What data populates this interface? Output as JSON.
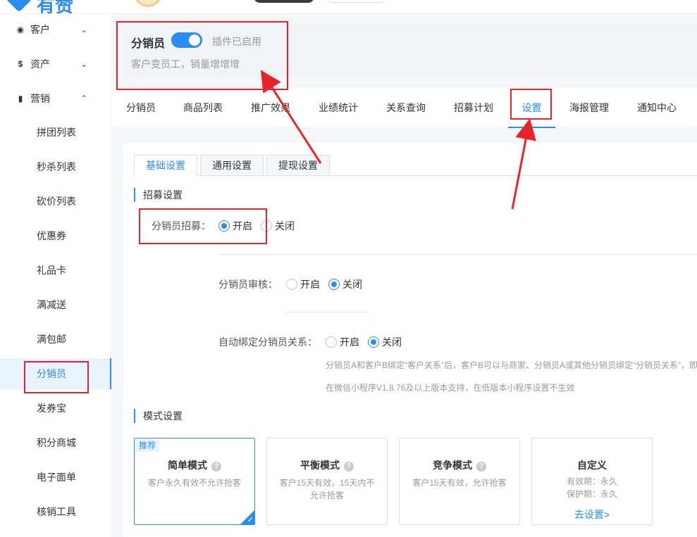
{
  "app": {
    "logo_text": "有赞"
  },
  "sidebar": {
    "groups": [
      {
        "icon": "customers-icon",
        "label": "客户",
        "expanded": false
      },
      {
        "icon": "assets-icon",
        "label": "资产",
        "expanded": false
      },
      {
        "icon": "marketing-icon",
        "label": "营销",
        "expanded": true
      }
    ],
    "items": [
      {
        "label": "拼团列表"
      },
      {
        "label": "秒杀列表"
      },
      {
        "label": "砍价列表"
      },
      {
        "label": "优惠券"
      },
      {
        "label": "礼品卡"
      },
      {
        "label": "满减送"
      },
      {
        "label": "满包邮"
      },
      {
        "label": "分销员",
        "active": true
      },
      {
        "label": "发券宝"
      },
      {
        "label": "积分商城"
      },
      {
        "label": "电子面单"
      },
      {
        "label": "核销工具"
      }
    ]
  },
  "plugin": {
    "title": "分销员",
    "enabled": true,
    "status": "插件已启用",
    "description": "客户变员工，销量增增增"
  },
  "main_tabs": [
    {
      "label": "分销员"
    },
    {
      "label": "商品列表"
    },
    {
      "label": "推广效果"
    },
    {
      "label": "业绩统计"
    },
    {
      "label": "关系查询"
    },
    {
      "label": "招募计划"
    },
    {
      "label": "设置",
      "active": true
    },
    {
      "label": "海报管理"
    },
    {
      "label": "通知中心"
    }
  ],
  "sub_tabs": [
    {
      "label": "基础设置",
      "active": true
    },
    {
      "label": "通用设置"
    },
    {
      "label": "提现设置"
    }
  ],
  "recruit_section": {
    "title": "招募设置",
    "recruit": {
      "label": "分销员招募：",
      "options": [
        "开启",
        "关闭"
      ],
      "selected": "开启"
    },
    "audit": {
      "label": "分销员审核：",
      "options": [
        "开启",
        "关闭"
      ],
      "selected": "关闭"
    },
    "auto_bind": {
      "label": "自动绑定分销员关系：",
      "options": [
        "开启",
        "关闭"
      ],
      "selected": "关闭"
    },
    "note1": "分销员A和客户B绑定“客户关系”后，客户B可以与商家、分销员A或其他分销员绑定“分销员关系”，即",
    "note2": "在微信小程序V1.8.76及以上版本支持，在低版本小程序设置不生效"
  },
  "mode_section": {
    "title": "模式设置",
    "modes": [
      {
        "name": "简单模式",
        "desc": "客户永久有效不允许抢客",
        "badge": "推荐",
        "selected": true
      },
      {
        "name": "平衡模式",
        "desc": "客户15天有效，15天内不允许抢客"
      },
      {
        "name": "竞争模式",
        "desc": "客户15天有效，允许抢客"
      }
    ],
    "custom": {
      "name": "自定义",
      "validity": "有效期：永久",
      "protection": "保护期：永久",
      "link": "去设置>"
    }
  },
  "colors": {
    "accent": "#2d8cf0",
    "annotation": "#e8232a"
  }
}
